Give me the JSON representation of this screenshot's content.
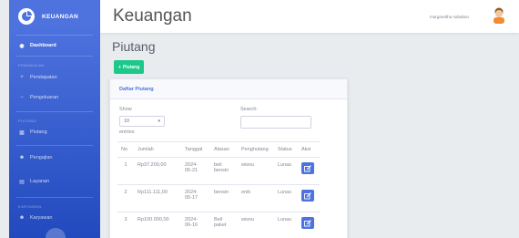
{
  "brand": {
    "name": "KEUANGAN",
    "logo_icon": "piechart-icon"
  },
  "sidebar": {
    "dashboard": "Dashboard",
    "heading_1": "PEMASUKAN",
    "item_pendapatan": "Pendapatan",
    "item_pengeluaran": "Pengeluaran",
    "heading_2": "PIUTANG",
    "item_piutang": "Piutang",
    "item_pengajian": "Pengajian",
    "item_layanan": "Layanan",
    "heading_3": "KARYAWAN",
    "item_karyawan": "Karyawan"
  },
  "topbar": {
    "title": "Keuangan",
    "user": "margarettha nababan"
  },
  "page": {
    "title": "Piutang",
    "add_button": "Piutang"
  },
  "card": {
    "title": "Daftar Piutang",
    "show_label": "Show",
    "entries_value": "10",
    "entries_label": "entries",
    "search_label": "Search:"
  },
  "table": {
    "headers": [
      "No",
      "Jumlah",
      "Tanggal",
      "Alasan",
      "Penghutang",
      "Status",
      "Aksi"
    ],
    "rows": [
      {
        "no": "1",
        "jumlah": "Rp37.200,00",
        "tanggal_1": "2024-",
        "tanggal_2": "05-21",
        "alasan_1": "beli",
        "alasan_2": "bensin",
        "penghutang": "wisnu",
        "status": "Lunas"
      },
      {
        "no": "2",
        "jumlah": "Rp111.111,00",
        "tanggal_1": "2024-",
        "tanggal_2": "05-17",
        "alasan_1": "bensin",
        "alasan_2": "",
        "penghutang": "enik",
        "status": "Lunas"
      },
      {
        "no": "3",
        "jumlah": "Rp100.000,00",
        "tanggal_1": "2024-",
        "tanggal_2": "06-16",
        "alasan_1": "Beli",
        "alasan_2": "paket",
        "penghutang": "wisnu",
        "status": "Lunas"
      }
    ]
  },
  "colors": {
    "sidebar": "#4e73df",
    "success": "#1cc88a",
    "primary": "#4e73df"
  }
}
